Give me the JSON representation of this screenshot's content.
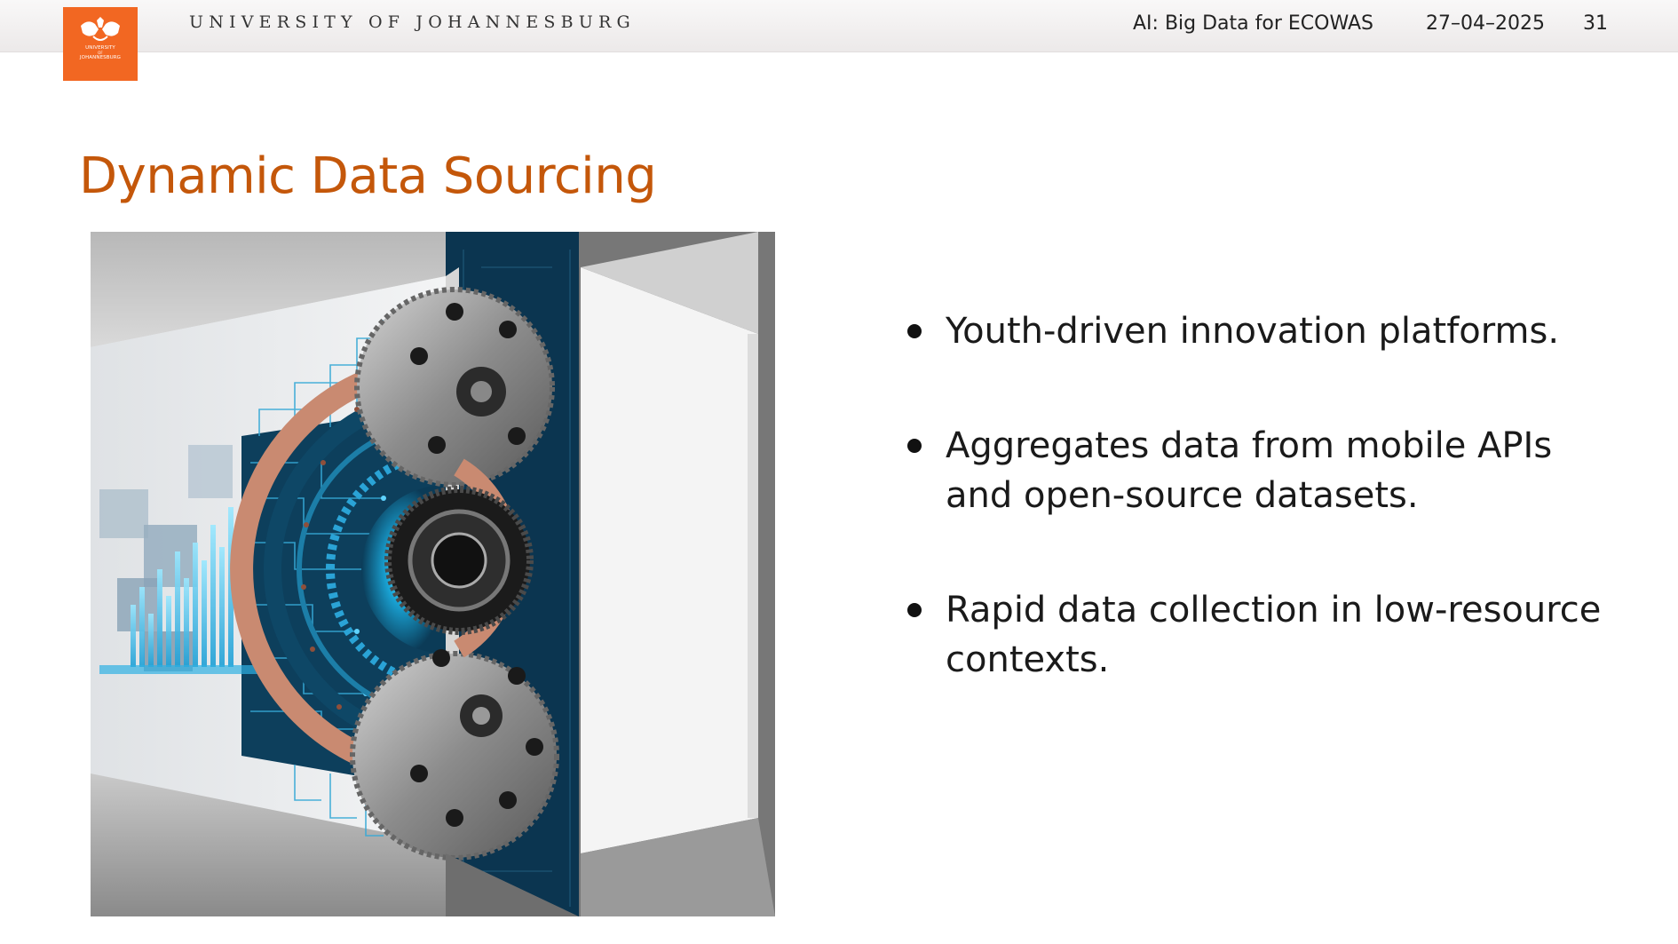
{
  "header": {
    "logo_text": [
      "UNIVERSITY",
      "OF",
      "JOHANNESBURG"
    ],
    "university_name": "UNIVERSITY OF JOHANNESBURG",
    "short_title": "AI: Big Data for ECOWAS",
    "date": "27–04–2025",
    "page_number": "31"
  },
  "slide": {
    "title": "Dynamic Data Sourcing",
    "bullets": [
      "Youth-driven innovation platforms.",
      "Aggregates data from mobile APIs and open-source datasets.",
      "Rapid data collection in low-resource contexts."
    ]
  },
  "colors": {
    "logo": "#f26722",
    "title": "#c4570a",
    "circuit_blue": "#0f4d6e",
    "copper": "#c7826a"
  },
  "icons": [
    "uj-crest-icon"
  ]
}
